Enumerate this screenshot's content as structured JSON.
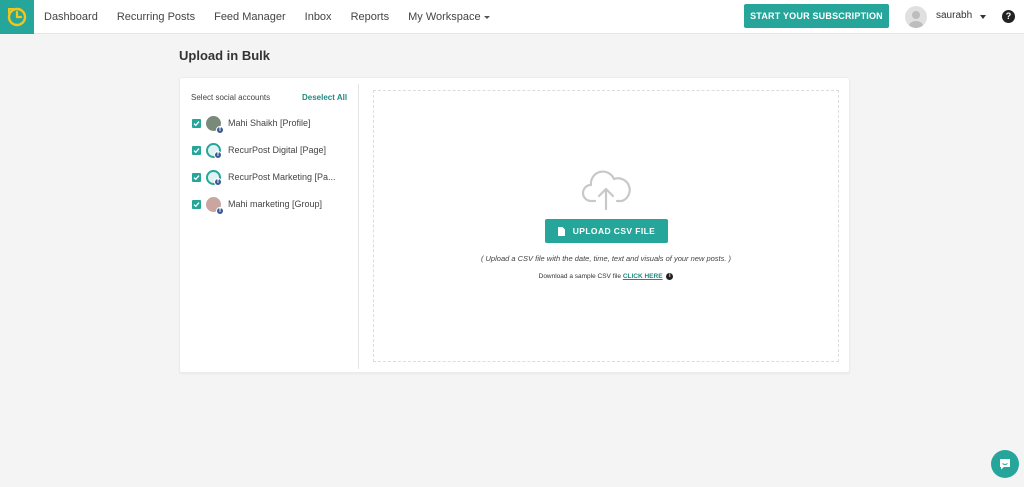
{
  "nav": {
    "items": [
      "Dashboard",
      "Recurring Posts",
      "Feed Manager",
      "Inbox",
      "Reports",
      "My Workspace"
    ],
    "subscription_button": "START YOUR SUBSCRIPTION",
    "username": "saurabh",
    "help": "?"
  },
  "page": {
    "title": "Upload in Bulk"
  },
  "accounts": {
    "header": "Select social accounts",
    "deselect_label": "Deselect All",
    "items": [
      {
        "name": "Mahi Shaikh [Profile]",
        "checked": true,
        "network": "facebook"
      },
      {
        "name": "RecurPost Digital [Page]",
        "checked": true,
        "network": "facebook"
      },
      {
        "name": "RecurPost Marketing [Pa...",
        "checked": true,
        "network": "facebook"
      },
      {
        "name": "Mahi marketing [Group]",
        "checked": true,
        "network": "facebook"
      }
    ]
  },
  "upload": {
    "button_label": "UPLOAD CSV FILE",
    "hint": "( Upload a CSV file with the date, time, text and visuals of your new posts. )",
    "sample_text": "Download a sample CSV file",
    "sample_link": "CLICK HERE"
  },
  "colors": {
    "accent": "#26a69a",
    "facebook": "#3b5998"
  },
  "icons": [
    "clock-logo-icon",
    "chevron-down-icon",
    "user-avatar-icon",
    "help-icon",
    "checkbox-checked-icon",
    "facebook-icon",
    "cloud-upload-icon",
    "file-icon",
    "info-icon",
    "chat-icon"
  ]
}
